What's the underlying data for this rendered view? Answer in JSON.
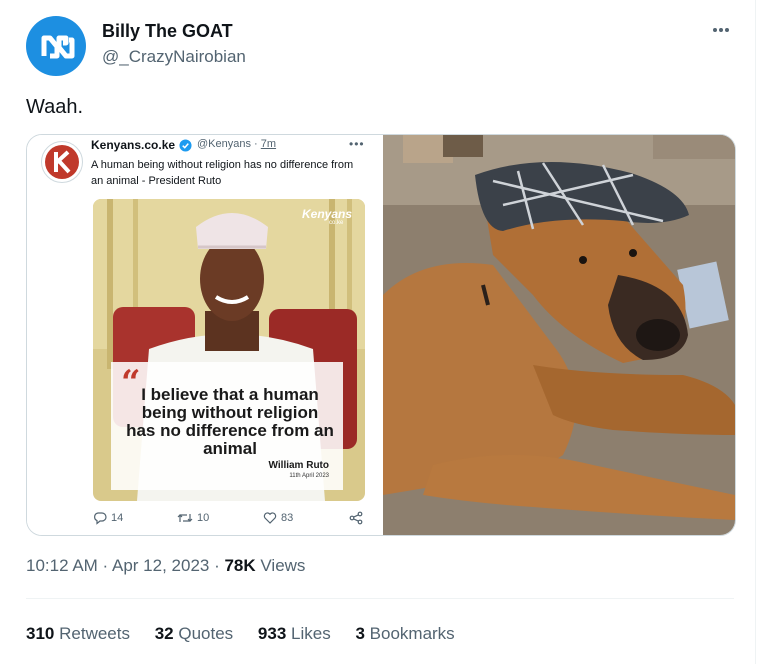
{
  "author": {
    "display_name": "Billy The GOAT",
    "handle": "@_CrazyNairobian"
  },
  "tweet": {
    "text": "Waah."
  },
  "quoted_screenshot": {
    "name": "Kenyans.co.ke",
    "handle": "@Kenyans",
    "separator": "·",
    "time": "7m",
    "text": "A human being without religion has no difference from an animal - President Ruto",
    "brand": "Kenyans",
    "brand_sub": "co.ke",
    "quote": "I believe that a human being without religion has no difference from an animal",
    "quote_author": "William Ruto",
    "quote_date": "11th April 2023",
    "actions": {
      "replies": "14",
      "retweets": "10",
      "likes": "83"
    },
    "accent_color": "#c0392b"
  },
  "meta": {
    "time": "10:12 AM",
    "date": "Apr 12, 2023",
    "views_count": "78K",
    "views_label": "Views"
  },
  "stats": {
    "retweets_count": "310",
    "retweets_label": "Retweets",
    "quotes_count": "32",
    "quotes_label": "Quotes",
    "likes_count": "933",
    "likes_label": "Likes",
    "bookmarks_count": "3",
    "bookmarks_label": "Bookmarks"
  },
  "colors": {
    "avatar_blue": "#1d8fe1",
    "text_primary": "#0f1419",
    "text_secondary": "#536471",
    "verified_blue": "#1d9bf0"
  }
}
